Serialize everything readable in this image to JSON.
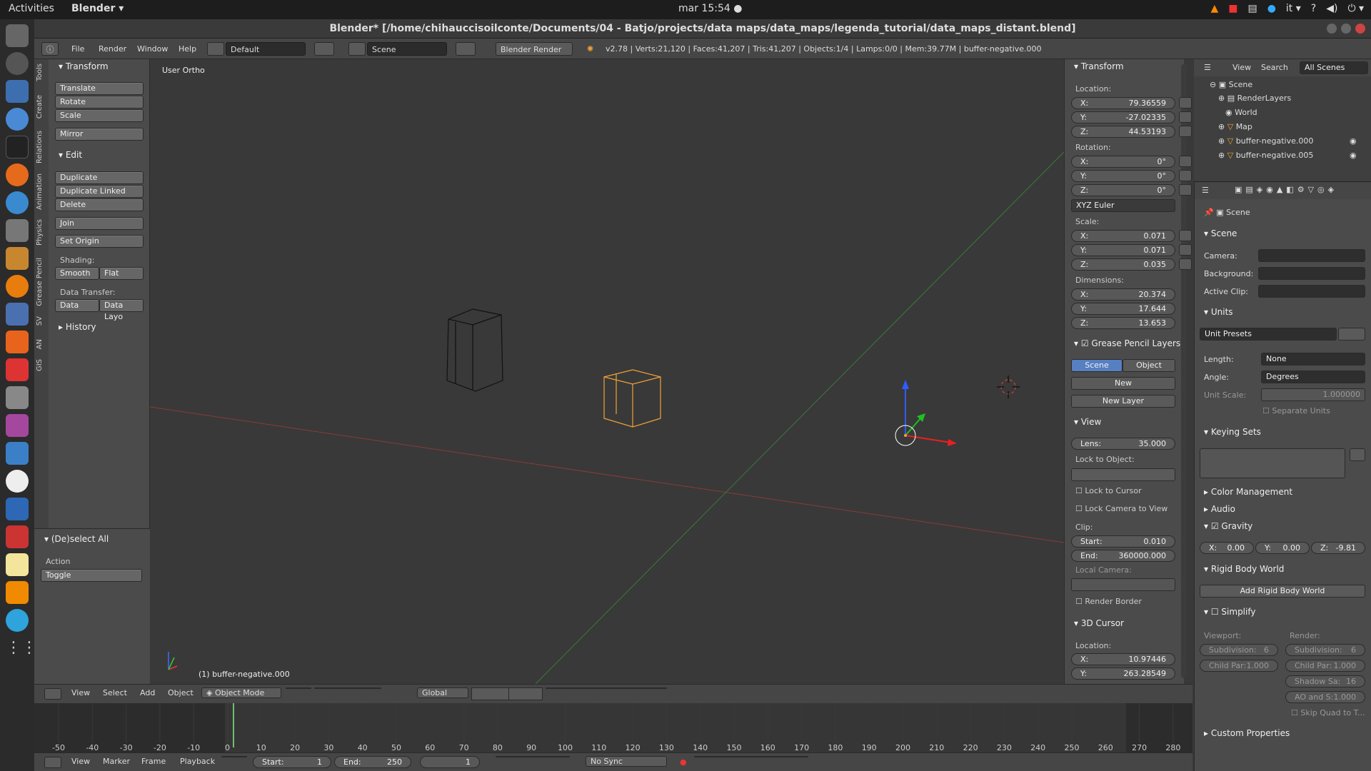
{
  "topbar": {
    "activities": "Activities",
    "app_menu": "Blender ▾",
    "clock": "mar 15:54 ●",
    "lang": "it ▾",
    "help": "?",
    "vol": "◀)",
    "power": "⏻ ▾"
  },
  "window_title": "Blender* [/home/chihauccisoilconte/Documents/04 - Batjo/projects/data maps/data_maps/legenda_tutorial/data_maps_distant.blend]",
  "info": {
    "menus": [
      "File",
      "Render",
      "Window",
      "Help"
    ],
    "layout": "Default",
    "scene": "Scene",
    "engine": "Blender Render",
    "stats": "v2.78 | Verts:21,120 | Faces:41,207 | Tris:41,207 | Objects:1/4 | Lamps:0/0 | Mem:39.77M | buffer-negative.000"
  },
  "tool_tabs": [
    "Tools",
    "Create",
    "Relations",
    "Animation",
    "Physics",
    "Grease Pencil",
    "SV",
    "AN",
    "GIS"
  ],
  "tools": {
    "transform_h": "Transform",
    "translate": "Translate",
    "rotate": "Rotate",
    "scale": "Scale",
    "mirror": "Mirror",
    "edit_h": "Edit",
    "duplicate": "Duplicate",
    "duplicate_linked": "Duplicate Linked",
    "delete": "Delete",
    "join": "Join",
    "set_origin": "Set Origin",
    "shading": "Shading:",
    "smooth": "Smooth",
    "flat": "Flat",
    "data_transfer": "Data Transfer:",
    "data": "Data",
    "data_layo": "Data Layo",
    "history": "History",
    "deselect_h": "(De)select All",
    "action": "Action",
    "toggle": "Toggle"
  },
  "viewport": {
    "view_name": "User Ortho",
    "object_label": "(1) buffer-negative.000"
  },
  "npanel": {
    "transform_h": "Transform",
    "location": "Location:",
    "loc": [
      {
        "k": "X:",
        "v": "79.36559"
      },
      {
        "k": "Y:",
        "v": "-27.02335"
      },
      {
        "k": "Z:",
        "v": "44.53193"
      }
    ],
    "rotation": "Rotation:",
    "rot": [
      {
        "k": "X:",
        "v": "0°"
      },
      {
        "k": "Y:",
        "v": "0°"
      },
      {
        "k": "Z:",
        "v": "0°"
      }
    ],
    "euler": "XYZ Euler",
    "scale": "Scale:",
    "scl": [
      {
        "k": "X:",
        "v": "0.071"
      },
      {
        "k": "Y:",
        "v": "0.071"
      },
      {
        "k": "Z:",
        "v": "0.035"
      }
    ],
    "dimensions": "Dimensions:",
    "dim": [
      {
        "k": "X:",
        "v": "20.374"
      },
      {
        "k": "Y:",
        "v": "17.644"
      },
      {
        "k": "Z:",
        "v": "13.653"
      }
    ],
    "gp_h": "Grease Pencil Layers",
    "gp_scene": "Scene",
    "gp_object": "Object",
    "gp_new": "New",
    "gp_newlayer": "New Layer",
    "view_h": "View",
    "lens_k": "Lens:",
    "lens_v": "35.000",
    "lock_to_object": "Lock to Object:",
    "lock_cursor": "Lock to Cursor",
    "lock_camera": "Lock Camera to View",
    "clip": "Clip:",
    "clip_start_k": "Start:",
    "clip_start_v": "0.010",
    "clip_end_k": "End:",
    "clip_end_v": "360000.000",
    "local_camera": "Local Camera:",
    "render_border": "Render Border",
    "cursor_h": "3D Cursor",
    "cursor_loc": "Location:",
    "cur": [
      {
        "k": "X:",
        "v": "10.97446"
      },
      {
        "k": "Y:",
        "v": "263.28549"
      }
    ]
  },
  "outliner": {
    "view": "View",
    "search": "Search",
    "all_scenes": "All Scenes",
    "items": [
      "Scene",
      "RenderLayers",
      "World",
      "Map",
      "buffer-negative.000",
      "buffer-negative.005"
    ]
  },
  "props": {
    "breadcrumb": "Scene",
    "scene_h": "Scene",
    "camera": "Camera:",
    "background": "Background:",
    "active_clip": "Active Clip:",
    "units_h": "Units",
    "unit_presets": "Unit Presets",
    "length": "Length:",
    "length_v": "None",
    "angle": "Angle:",
    "angle_v": "Degrees",
    "unit_scale": "Unit Scale:",
    "unit_scale_v": "1.000000",
    "separate_units": "Separate Units",
    "keying_h": "Keying Sets",
    "color_mgmt": "Color Management",
    "audio": "Audio",
    "gravity": "Gravity",
    "gx": "X:",
    "gx_v": "0.00",
    "gy": "Y:",
    "gy_v": "0.00",
    "gz": "Z:",
    "gz_v": "-9.81",
    "rigid_h": "Rigid Body World",
    "add_rigid": "Add Rigid Body World",
    "simplify": "Simplify",
    "viewport": "Viewport:",
    "render": "Render:",
    "subdiv_k": "Subdivision:",
    "subdiv_v": "6",
    "childpar_k": "Child Par:",
    "childpar_v": "1.000",
    "shadow_k": "Shadow Sa:",
    "shadow_v": "16",
    "ao_k": "AO and S:",
    "ao_v": "1.000",
    "skip_quad": "Skip Quad to T...",
    "custom_props": "Custom Properties"
  },
  "vheader": {
    "view": "View",
    "select": "Select",
    "add": "Add",
    "object": "Object",
    "mode": "Object Mode",
    "orientation": "Global"
  },
  "timeline": {
    "ticks": [
      "-50",
      "-40",
      "-30",
      "-20",
      "-10",
      "0",
      "10",
      "20",
      "30",
      "40",
      "50",
      "60",
      "70",
      "80",
      "90",
      "100",
      "110",
      "120",
      "130",
      "140",
      "150",
      "160",
      "170",
      "180",
      "190",
      "200",
      "210",
      "220",
      "230",
      "240",
      "250",
      "260",
      "270",
      "280"
    ],
    "view": "View",
    "marker": "Marker",
    "frame": "Frame",
    "playback": "Playback",
    "start_k": "Start:",
    "start_v": "1",
    "end_k": "End:",
    "end_v": "250",
    "current": "1",
    "sync": "No Sync"
  },
  "colors": {
    "accent": "#5680c2",
    "selected": "#f1a236",
    "x_axis": "#c83c3c",
    "y_axis": "#3c9c3c"
  }
}
